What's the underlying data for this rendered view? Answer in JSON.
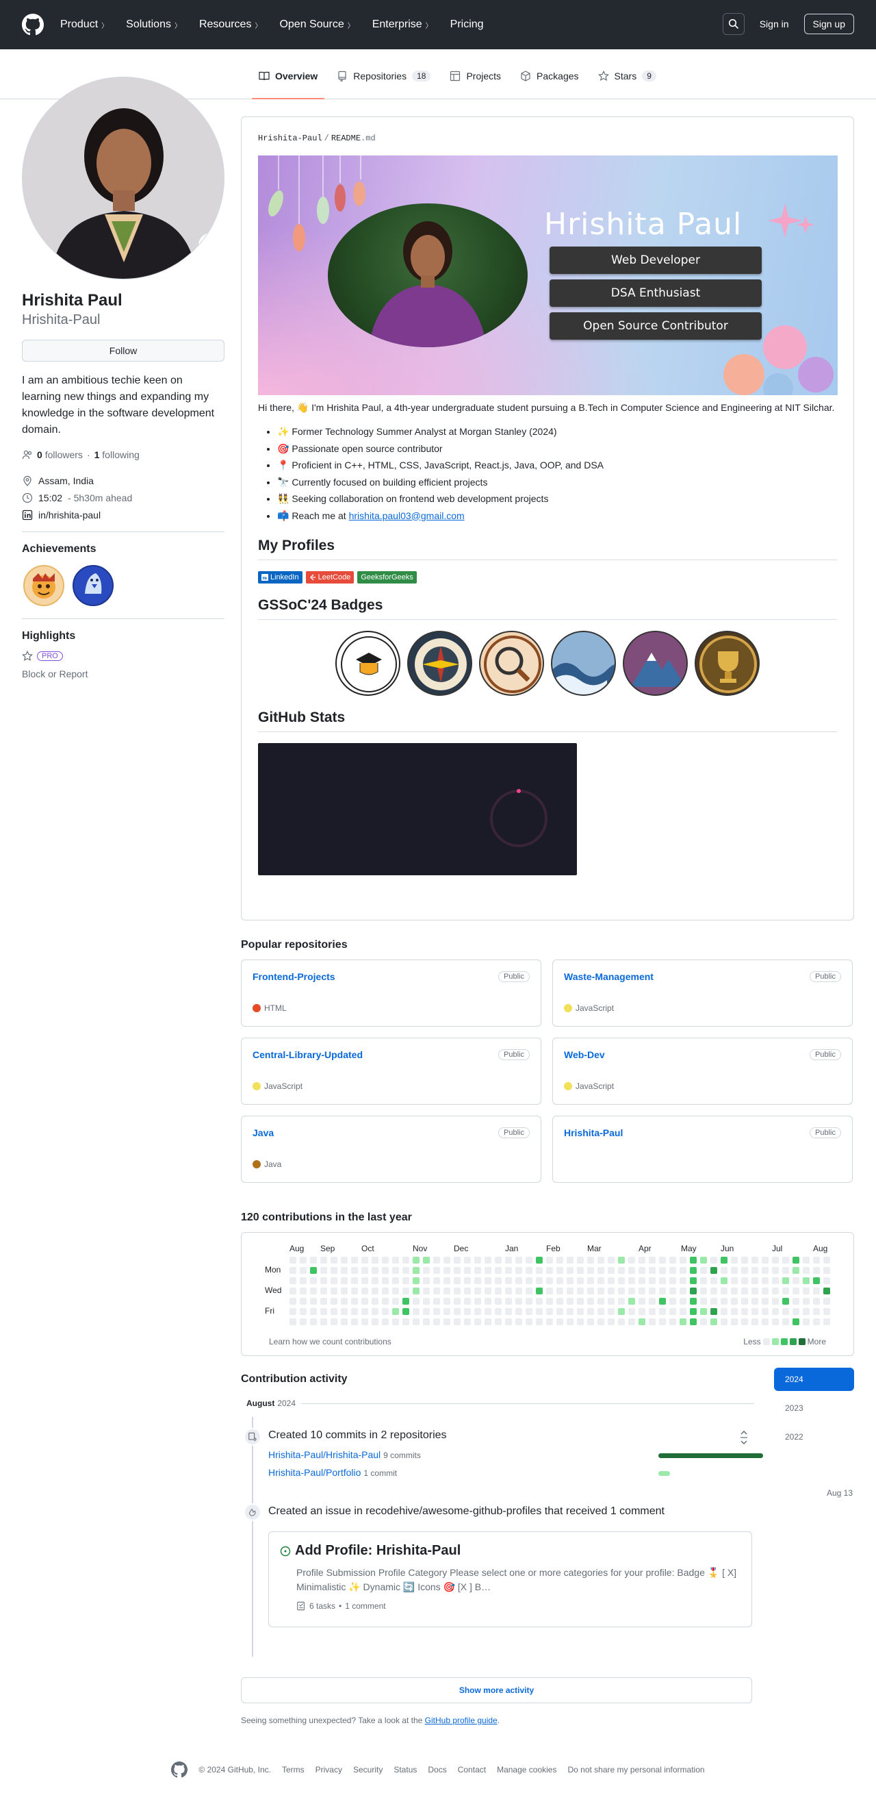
{
  "nav": {
    "items": [
      "Product",
      "Solutions",
      "Resources",
      "Open Source",
      "Enterprise",
      "Pricing"
    ],
    "signin": "Sign in",
    "signup": "Sign up"
  },
  "tabs": [
    {
      "label": "Overview",
      "icon": "book-icon"
    },
    {
      "label": "Repositories",
      "count": "18",
      "icon": "repo-icon"
    },
    {
      "label": "Projects",
      "icon": "table-icon"
    },
    {
      "label": "Packages",
      "icon": "package-icon"
    },
    {
      "label": "Stars",
      "count": "9",
      "icon": "star-icon"
    }
  ],
  "profile": {
    "name": "Hrishita Paul",
    "login": "Hrishita-Paul",
    "follow_label": "Follow",
    "status_emoji": "🎯",
    "bio": "I am an ambitious techie keen on learning new things and expanding my knowledge in the software development domain.",
    "followers": "0",
    "followers_label": "followers",
    "following": "1",
    "following_label": "following",
    "location": "Assam, India",
    "time": "15:02",
    "time_note": "- 5h30m ahead",
    "linkedin": "in/hrishita-paul",
    "achievements_title": "Achievements",
    "highlights_title": "Highlights",
    "pro": "PRO",
    "block": "Block or Report"
  },
  "readme": {
    "owner": "Hrishita-Paul",
    "file": "README",
    "ext": ".md",
    "banner_name": "Hrishita Paul",
    "banner_roles": [
      "Web Developer",
      "DSA Enthusiast",
      "Open Source Contributor"
    ],
    "intro": "Hi there, 👋 I'm Hrishita Paul, a 4th-year undergraduate student pursuing a B.Tech in Computer Science and Engineering at NIT Silchar.",
    "bullets": [
      "✨ Former Technology Summer Analyst at Morgan Stanley (2024)",
      "🎯 Passionate open source contributor",
      "📍 Proficient in C++, HTML, CSS, JavaScript, React.js, Java, OOP, and DSA",
      "🔭 Currently focused on building efficient projects",
      "👯 Seeking collaboration on frontend web development projects"
    ],
    "reach_prefix": "📫 Reach me at ",
    "email": "hrishita.paul03@gmail.com",
    "profiles_title": "My Profiles",
    "profile_badges": [
      {
        "label": "LinkedIn",
        "color": "#0a66c2"
      },
      {
        "label": "LeetCode",
        "color": "#e64b3b"
      },
      {
        "label": "GeeksforGeeks",
        "color": "#2f8d46"
      }
    ],
    "gssoc_title": "GSSoC'24 Badges",
    "stats_title": "GitHub Stats"
  },
  "popular": {
    "title": "Popular repositories",
    "repos": [
      {
        "name": "Frontend-Projects",
        "vis": "Public",
        "lang": "HTML",
        "color": "#e34c26"
      },
      {
        "name": "Waste-Management",
        "vis": "Public",
        "lang": "JavaScript",
        "color": "#f1e05a"
      },
      {
        "name": "Central-Library-Updated",
        "vis": "Public",
        "lang": "JavaScript",
        "color": "#f1e05a"
      },
      {
        "name": "Web-Dev",
        "vis": "Public",
        "lang": "JavaScript",
        "color": "#f1e05a"
      },
      {
        "name": "Java",
        "vis": "Public",
        "lang": "Java",
        "color": "#b07219"
      },
      {
        "name": "Hrishita-Paul",
        "vis": "Public",
        "lang": "",
        "color": ""
      }
    ]
  },
  "contributions": {
    "title": "120 contributions in the last year",
    "months": [
      "Aug",
      "Sep",
      "Oct",
      "Nov",
      "Dec",
      "Jan",
      "Feb",
      "Mar",
      "Apr",
      "May",
      "Jun",
      "Jul",
      "Aug"
    ],
    "days": [
      "Mon",
      "Wed",
      "Fri"
    ],
    "learn": "Learn how we count contributions",
    "less": "Less",
    "more": "More",
    "levels": [
      "#ebedf0",
      "#9be9a8",
      "#40c463",
      "#30a14e",
      "#216e39"
    ]
  },
  "activity": {
    "title": "Contribution activity",
    "years": [
      "2024",
      "2023",
      "2022"
    ],
    "month": "August",
    "year": "2024",
    "commits_head": "Created 10 commits in 2 repositories",
    "commit_repos": [
      {
        "repo": "Hrishita-Paul/Hrishita-Paul",
        "count": "9 commits",
        "share": 0.9
      },
      {
        "repo": "Hrishita-Paul/Portfolio",
        "count": "1 commit",
        "share": 0.1
      }
    ],
    "issue_head": "Created an issue in recodehive/awesome-github-profiles that received 1 comment",
    "issue_date": "Aug 13",
    "issue_title": "Add Profile: Hrishita-Paul",
    "issue_body": "Profile Submission Profile Category Please select one or more categories for your profile: Badge 🎖️ [ X] Minimalistic ✨ Dynamic 🔄 Icons 🎯 [X ] B…",
    "issue_tasks": "6 tasks",
    "issue_comments": "1 comment",
    "show_more": "Show more activity",
    "unexpected_prefix": "Seeing something unexpected? Take a look at the ",
    "guide": "GitHub profile guide",
    "unexpected_suffix": "."
  },
  "footer": {
    "copyright": "© 2024 GitHub, Inc.",
    "links": [
      "Terms",
      "Privacy",
      "Security",
      "Status",
      "Docs",
      "Contact",
      "Manage cookies",
      "Do not share my personal information"
    ]
  }
}
